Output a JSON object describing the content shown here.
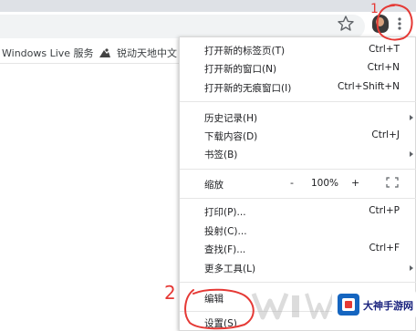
{
  "bookmarks_bar": {
    "items": [
      {
        "label": "Windows Live 服务"
      },
      {
        "label": "锐动天地中文"
      }
    ]
  },
  "menu": {
    "new_tab": {
      "label": "打开新的标签页(T)",
      "shortcut": "Ctrl+T"
    },
    "new_window": {
      "label": "打开新的窗口(N)",
      "shortcut": "Ctrl+N"
    },
    "new_incognito": {
      "label": "打开新的无痕窗口(I)",
      "shortcut": "Ctrl+Shift+N"
    },
    "history": {
      "label": "历史记录(H)"
    },
    "downloads": {
      "label": "下载内容(D)",
      "shortcut": "Ctrl+J"
    },
    "bookmarks": {
      "label": "书签(B)"
    },
    "zoom": {
      "label": "缩放",
      "minus": "-",
      "value": "100%",
      "plus": "+"
    },
    "print": {
      "label": "打印(P)...",
      "shortcut": "Ctrl+P"
    },
    "cast": {
      "label": "投射(C)..."
    },
    "find": {
      "label": "查找(F)...",
      "shortcut": "Ctrl+F"
    },
    "more_tools": {
      "label": "更多工具(L)"
    },
    "edit": {
      "label": "编辑"
    },
    "settings": {
      "label": "设置(S)"
    }
  },
  "annotations": {
    "step1": "1",
    "step2": "2",
    "color": "#e53935"
  },
  "watermark": {
    "brand_text": "大神手游网"
  }
}
